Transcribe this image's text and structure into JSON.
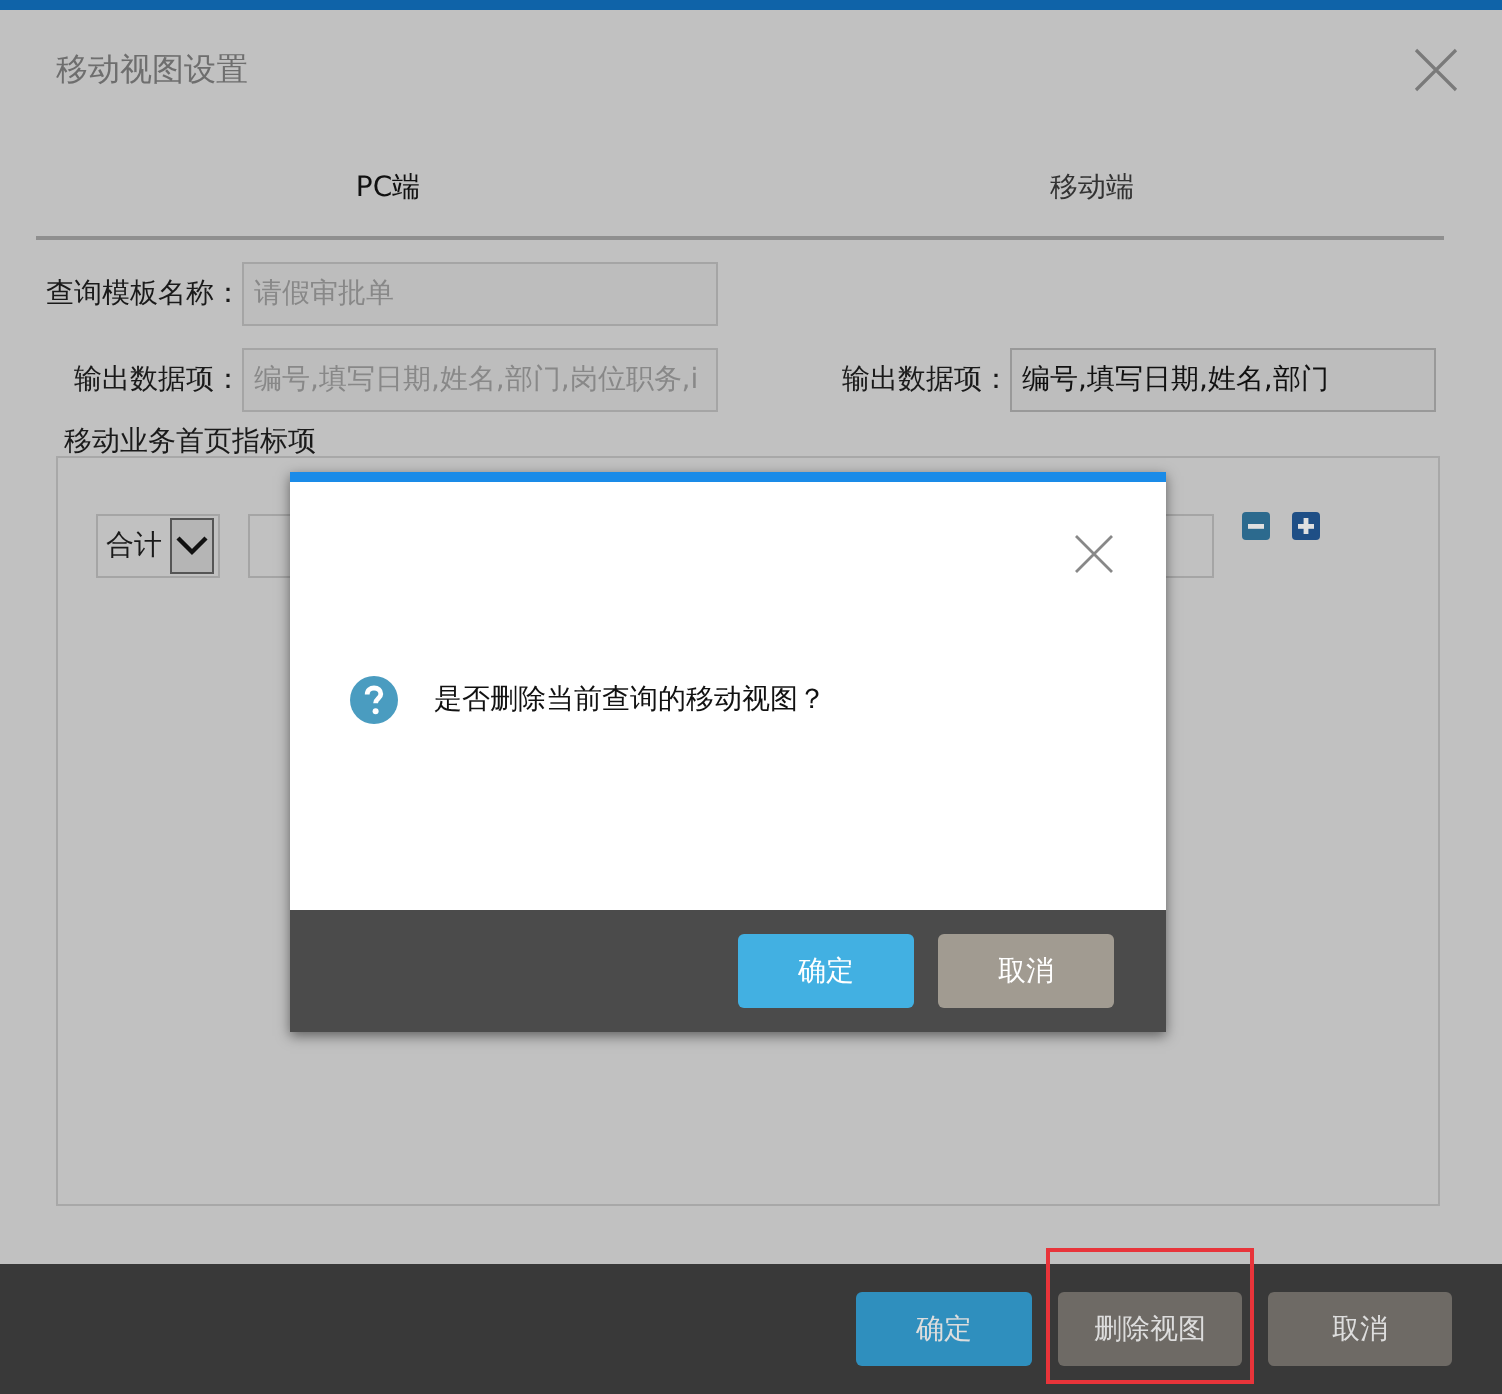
{
  "window": {
    "title": "移动视图设置"
  },
  "tabs": [
    {
      "label": "PC端",
      "selected": true
    },
    {
      "label": "移动端",
      "selected": false
    }
  ],
  "template_name": {
    "label": "查询模板名称：",
    "value": "请假审批单",
    "disabled": true
  },
  "output_fields": [
    {
      "label": "输出数据项：",
      "value": "编号,填写日期,姓名,部门,岗位职务,i",
      "disabled": true
    },
    {
      "label": "输出数据项：",
      "value": "编号,填写日期,姓名,部门",
      "disabled": false
    }
  ],
  "indicators": {
    "title": "移动业务首页指标项",
    "rows": [
      {
        "aggregate": "合计"
      }
    ]
  },
  "buttons": [
    {
      "label": "确定",
      "kind": "primary",
      "highlighted": false
    },
    {
      "label": "删除视图",
      "kind": "secondary",
      "highlighted": true
    },
    {
      "label": "取消",
      "kind": "secondary",
      "highlighted": false
    }
  ],
  "confirm": {
    "message": "是否删除当前查询的移动视图？",
    "buttons": [
      {
        "label": "确定",
        "kind": "primary"
      },
      {
        "label": "取消",
        "kind": "secondary"
      }
    ]
  }
}
